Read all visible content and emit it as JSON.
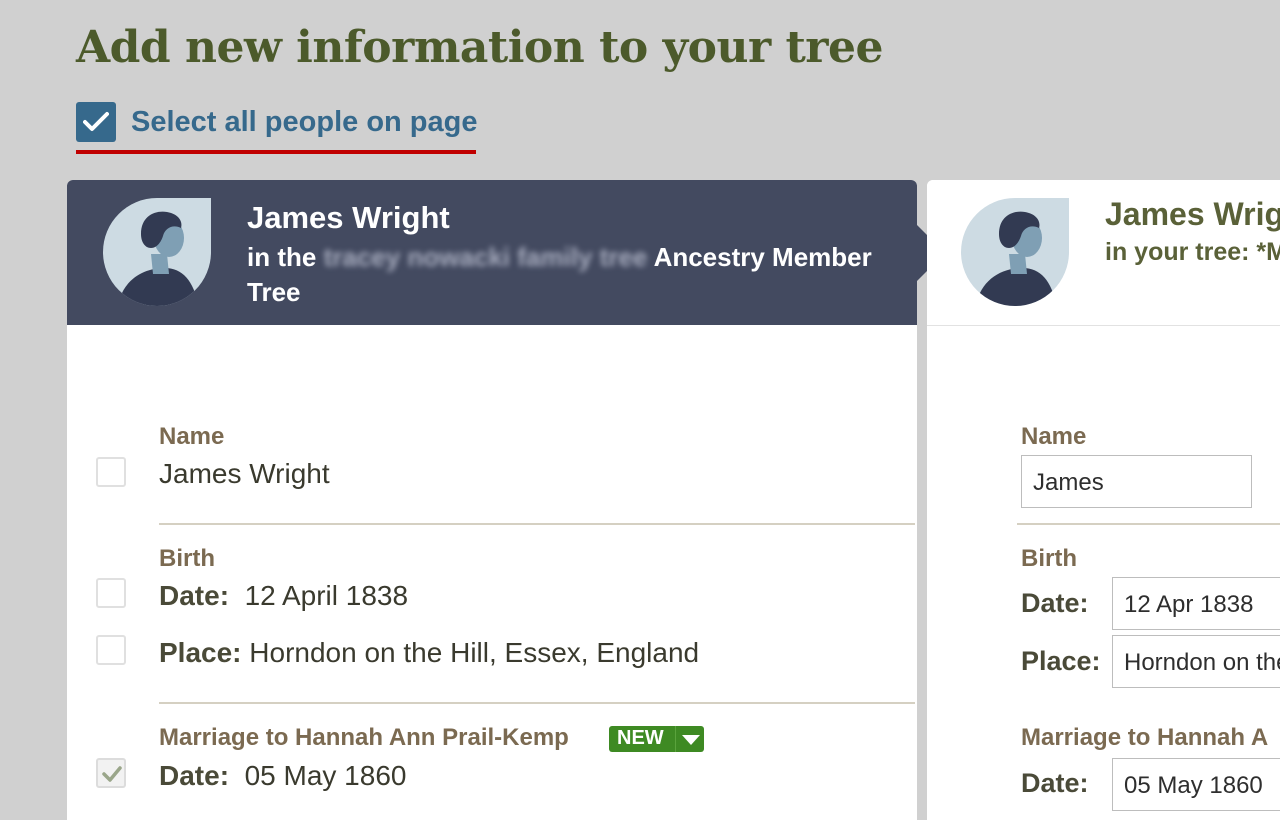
{
  "page": {
    "title": "Add new information to your tree",
    "select_all_label": "Select all people on page"
  },
  "source_person": {
    "name": "James Wright",
    "subtitle_prefix": "in the",
    "tree_name_redacted": "tracey nowacki family tree",
    "subtitle_suffix": "Ancestry Member Tree",
    "fields": {
      "name_label": "Name",
      "name_value": "James Wright",
      "birth_label": "Birth",
      "birth_date_key": "Date:",
      "birth_date_value": "12 April 1838",
      "birth_place_key": "Place:",
      "birth_place_value": "Horndon on the Hill, Essex, England",
      "marriage_label": "Marriage to Hannah Ann Prail-Kemp",
      "marriage_badge": "NEW",
      "marriage_date_key": "Date:",
      "marriage_date_value": "05 May 1860"
    },
    "checked": {
      "name": false,
      "birth_date": false,
      "birth_place": false,
      "marriage_date": true
    }
  },
  "tree_person": {
    "name": "James Wrig",
    "subtitle": "in your tree: *M",
    "fields": {
      "name_label": "Name",
      "name_input": "James",
      "birth_label": "Birth",
      "birth_date_key": "Date:",
      "birth_date_input": "12 Apr 1838",
      "birth_place_key": "Place:",
      "birth_place_input": "Horndon on the",
      "marriage_label": "Marriage to Hannah A",
      "marriage_date_key": "Date:",
      "marriage_date_input": "05 May 1860"
    }
  },
  "colors": {
    "header_bg": "#434a60",
    "accent_blue": "#36698c",
    "new_badge": "#3e8a23",
    "title_olive": "#4c5a2b"
  }
}
